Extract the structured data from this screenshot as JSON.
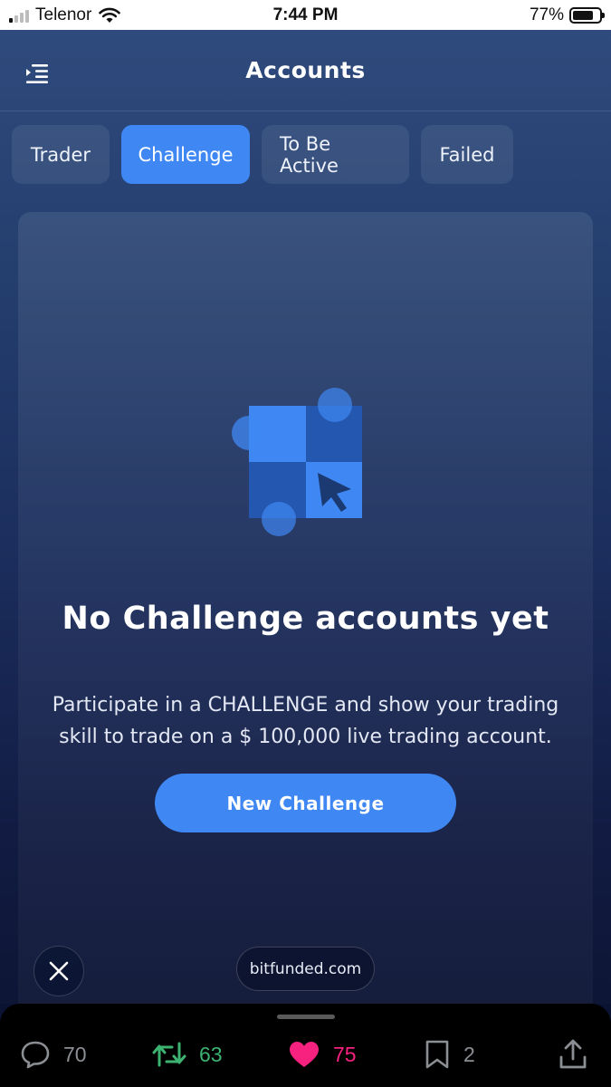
{
  "status_bar": {
    "carrier": "Telenor",
    "time": "7:44 PM",
    "battery": "77%",
    "battery_level": 0.77,
    "signal_bars_on": 1,
    "icons": [
      "signal-icon",
      "wifi-icon",
      "battery-icon"
    ]
  },
  "header": {
    "title": "Accounts",
    "menu_icon": "menu-indent-icon"
  },
  "tabs": [
    {
      "label": "Trader",
      "active": false
    },
    {
      "label": "Challenge",
      "active": true
    },
    {
      "label": "To Be Active",
      "active": false
    },
    {
      "label": "Failed",
      "active": false
    }
  ],
  "empty_state": {
    "illustration_icon": "checker-cursor-icon",
    "title": "No Challenge accounts yet",
    "description_line1": "Participate in a CHALLENGE and show your trading",
    "description_line2": "skill to trade on a $ 100,000 live trading account.",
    "button_label": "New Challenge"
  },
  "overlay": {
    "close_icon": "close-icon",
    "url": "bitfunded.com"
  },
  "actions": {
    "replies": "70",
    "retweets": "63",
    "likes": "75",
    "bookmarks": "2",
    "colors": {
      "retweet": "#3cb371",
      "like": "#f7217f",
      "neutral": "#8b8f94"
    }
  },
  "colors": {
    "accent": "#3f88f4",
    "background_top": "#2f4a7c",
    "background_bottom": "#0e1636"
  }
}
